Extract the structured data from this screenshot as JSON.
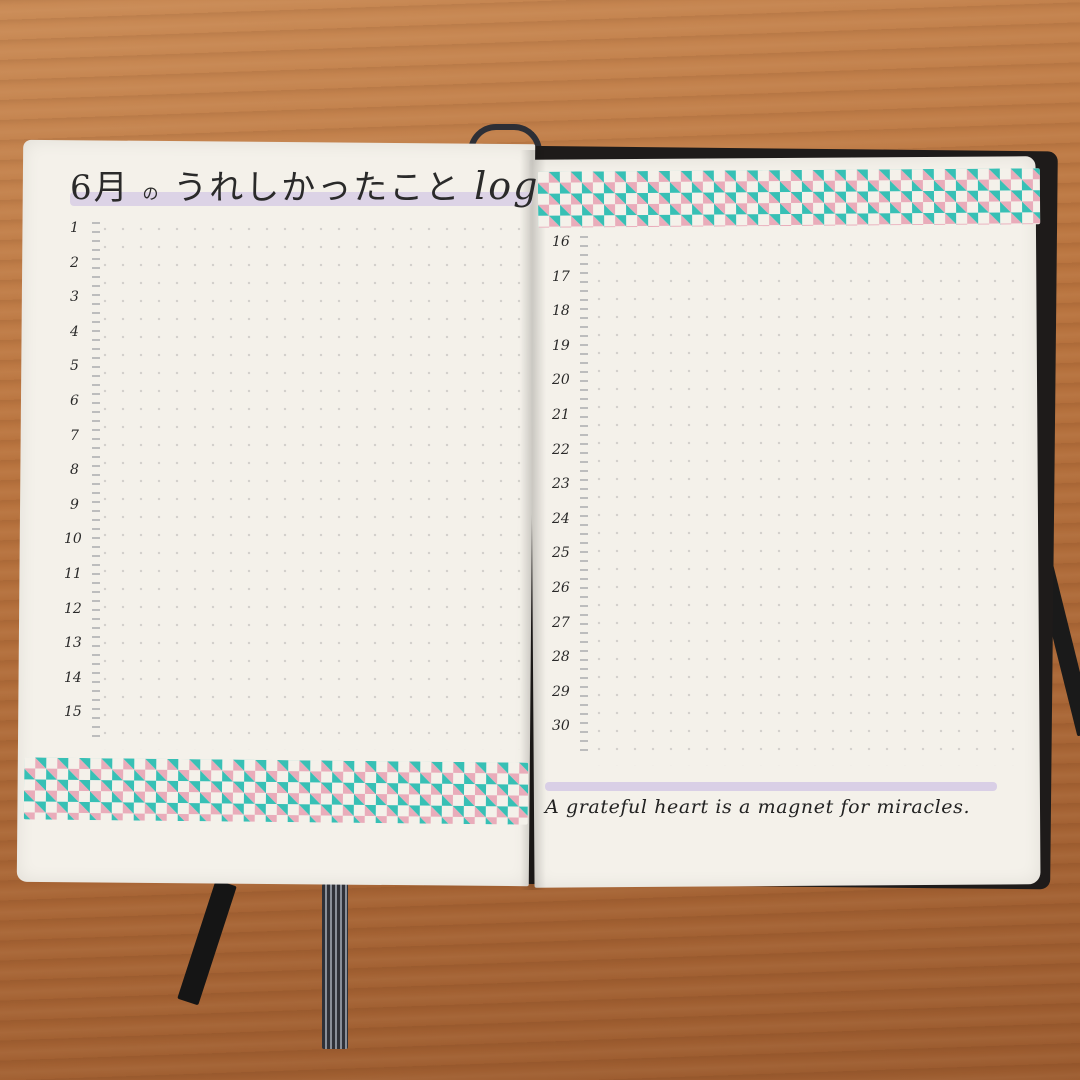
{
  "title": {
    "month": "6月",
    "particle": "の",
    "text": "うれしかったこと",
    "suffix": "log"
  },
  "left_days": [
    "1",
    "2",
    "3",
    "4",
    "5",
    "6",
    "7",
    "8",
    "9",
    "10",
    "11",
    "12",
    "13",
    "14",
    "15"
  ],
  "right_days": [
    "16",
    "17",
    "18",
    "19",
    "20",
    "21",
    "22",
    "23",
    "24",
    "25",
    "26",
    "27",
    "28",
    "29",
    "30"
  ],
  "quote": "A grateful heart is a magnet for miracles.",
  "colors": {
    "tape_teal": "#2dbdb3",
    "tape_pink": "#e8a8b8",
    "highlight_lavender": "#d9cfe6",
    "paper": "#f4f1ea",
    "desk": "#b9743f"
  }
}
